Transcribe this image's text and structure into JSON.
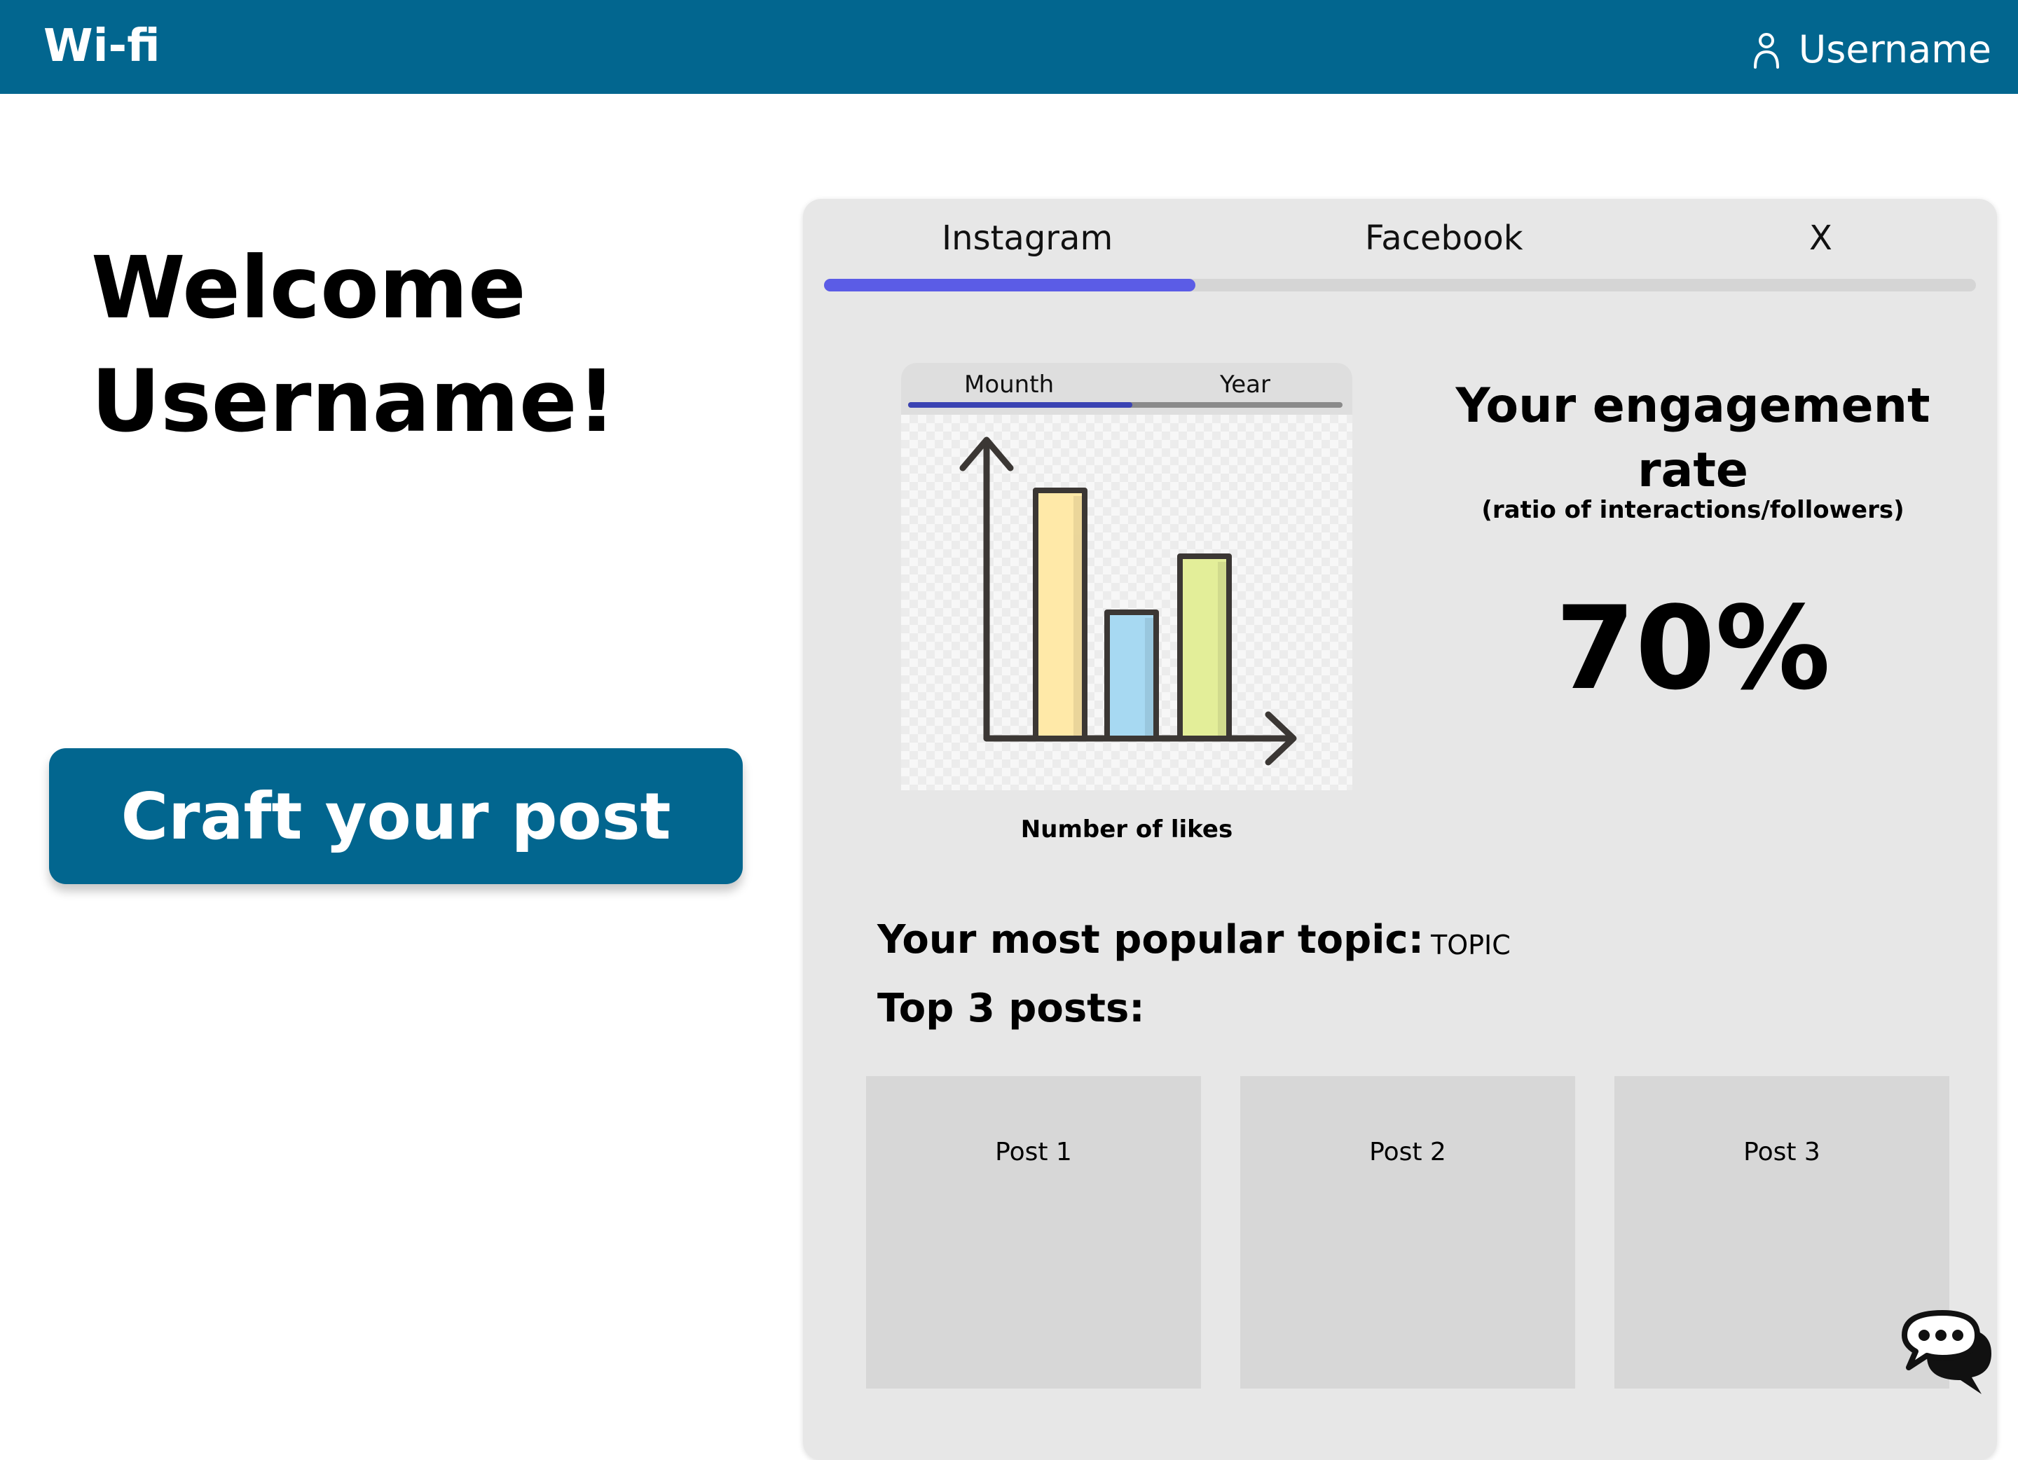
{
  "header": {
    "brand": "Wi-fi",
    "username": "Username"
  },
  "welcome": {
    "line1": "Welcome",
    "line2": "Username!"
  },
  "craft_button": "Craft your post",
  "platform_tabs": [
    {
      "label": "Instagram",
      "active": true
    },
    {
      "label": "Facebook",
      "active": false
    },
    {
      "label": "X",
      "active": false
    }
  ],
  "likes_chart": {
    "period_tabs": [
      {
        "label": "Mounth",
        "active": true
      },
      {
        "label": "Year",
        "active": false
      }
    ],
    "caption": "Number of likes",
    "icon": "bar-chart-icon"
  },
  "engagement": {
    "title": "Your engagement rate",
    "subtitle": "(ratio of interactions/followers)",
    "value": "70%"
  },
  "popular_topic": {
    "label": "Your most popular topic:",
    "value": "TOPIC"
  },
  "top_posts": {
    "label": "Top 3 posts:",
    "posts": [
      {
        "label": "Post 1"
      },
      {
        "label": "Post 2"
      },
      {
        "label": "Post 3"
      }
    ]
  },
  "chat": {
    "icon": "chat-bubbles-icon"
  },
  "colors": {
    "header_bg": "#02668f",
    "panel_bg": "#e7e7e7",
    "tab_active": "#5b5ce6",
    "chart_tab_active": "#3b43b3",
    "bar_colors": [
      "#ffe9a8",
      "#a7d9f2",
      "#e3ee99"
    ]
  }
}
